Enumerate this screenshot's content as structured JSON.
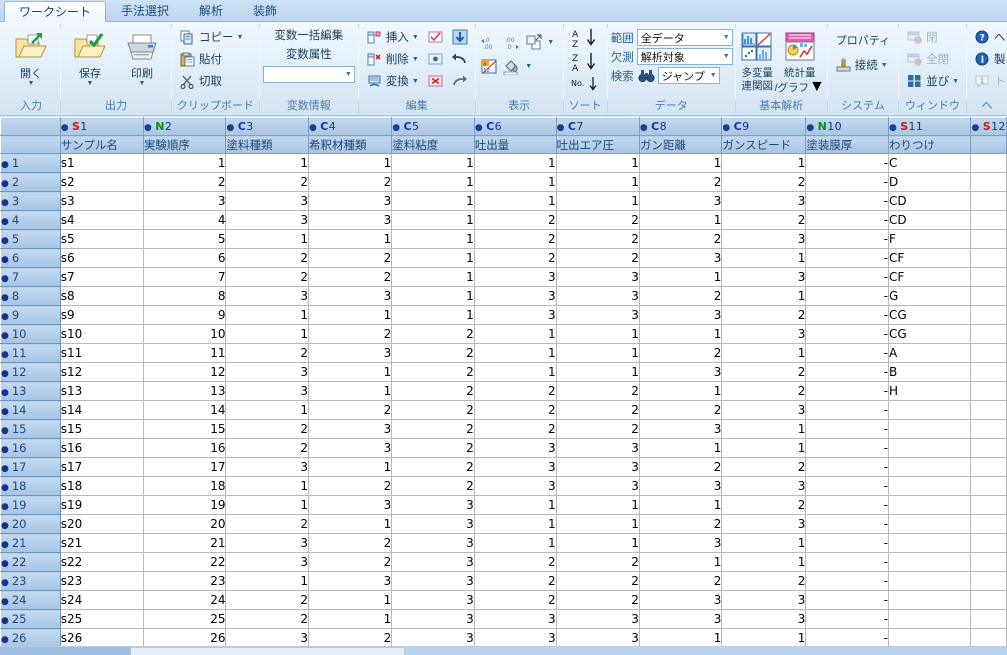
{
  "tabs": [
    {
      "label": "ワークシート",
      "active": true
    },
    {
      "label": "手法選択",
      "active": false
    },
    {
      "label": "解析",
      "active": false
    },
    {
      "label": "装飾",
      "active": false
    }
  ],
  "ribbon": {
    "groups": [
      {
        "title": "入力",
        "buttons": [
          {
            "label": "開く",
            "icon": "open-folder-icon",
            "dropdown": true
          }
        ]
      },
      {
        "title": "出力",
        "buttons": [
          {
            "label": "保存",
            "icon": "save-folder-icon",
            "dropdown": true
          },
          {
            "label": "印刷",
            "icon": "printer-icon",
            "dropdown": true
          }
        ]
      },
      {
        "title": "クリップボード",
        "buttons": [
          {
            "label": "コピー",
            "icon": "copy-icon",
            "dropdown": true
          },
          {
            "label": "貼付",
            "icon": "paste-icon",
            "dropdown": false
          },
          {
            "label": "切取",
            "icon": "scissors-icon",
            "dropdown": false
          }
        ]
      },
      {
        "title": "変数情報",
        "buttons": [
          {
            "label": "変数一括編集",
            "icon": "",
            "dropdown": false
          },
          {
            "label": "変数属性",
            "icon": "",
            "dropdown": false
          }
        ],
        "combo": {
          "value": "",
          "icon": "chevron-down-icon"
        }
      },
      {
        "title": "編集",
        "buttons": [
          {
            "label": "挿入",
            "icon": "insert-row-icon",
            "dropdown": true
          },
          {
            "label": "削除",
            "icon": "delete-row-icon",
            "dropdown": true
          },
          {
            "label": "変換",
            "icon": "convert-icon",
            "dropdown": true
          }
        ],
        "extra_icons": [
          "check-box-icon",
          "radio-cell-icon",
          "cross-cell-icon",
          "fill-down-icon",
          "undo-icon",
          "redo-icon"
        ]
      },
      {
        "title": "表示",
        "extra_icons": [
          "decimal-increase-icon",
          "decimal-decrease-icon",
          "resize-icon",
          "chevron-down-icon",
          "cell-format-icon",
          "fill-color-icon",
          "chevron-down-icon"
        ]
      },
      {
        "title": "ソート",
        "buttons": [
          {
            "label": "",
            "icon": "sort-az-icon"
          },
          {
            "label": "",
            "icon": "sort-za-icon"
          },
          {
            "label": "",
            "icon": "sort-no-icon"
          }
        ]
      },
      {
        "title": "データ",
        "fields": [
          {
            "label": "範囲",
            "value": "全データ",
            "type": "combo"
          },
          {
            "label": "欠測",
            "value": "解析対象",
            "type": "combo"
          },
          {
            "label": "検索",
            "value": "ジャンプ",
            "type": "combo",
            "icon": "binoculars-icon"
          }
        ]
      },
      {
        "title": "基本解析",
        "buttons": [
          {
            "label": "多変量\n連関図",
            "label_line1": "多変量",
            "label_line2": "連関図",
            "icon": "matrix-plot-icon"
          },
          {
            "label": "統計量\n/グラフ",
            "label_line1": "統計量",
            "label_line2": "/グラフ",
            "icon": "stats-graph-icon",
            "dropdown": true
          }
        ]
      },
      {
        "title": "システム",
        "buttons": [
          {
            "label": "プロパティ",
            "icon": ""
          },
          {
            "label": "接続",
            "icon": "connect-icon",
            "dropdown": true
          }
        ]
      },
      {
        "title": "ウィンドウ",
        "buttons": [
          {
            "label": "閉",
            "icon": "close-window-icon",
            "disabled": true
          },
          {
            "label": "全閉",
            "icon": "close-all-windows-icon",
            "disabled": true
          },
          {
            "label": "並び",
            "icon": "tile-windows-icon",
            "dropdown": true
          }
        ]
      },
      {
        "title": "ヘ",
        "buttons": [
          {
            "label": "ヘ",
            "icon": "help-icon"
          },
          {
            "label": "製",
            "icon": "info-icon"
          },
          {
            "label": "ト",
            "icon": "tip-icon",
            "disabled": true
          }
        ]
      }
    ]
  },
  "sheet": {
    "columns": [
      {
        "code_type": "S",
        "code_num": "1",
        "name": "サンプル名",
        "align": "txt",
        "width": 85
      },
      {
        "code_type": "N",
        "code_num": "2",
        "name": "実験順序",
        "align": "num",
        "width": 85
      },
      {
        "code_type": "C",
        "code_num": "3",
        "name": "塗料種類",
        "align": "num",
        "width": 85
      },
      {
        "code_type": "C",
        "code_num": "4",
        "name": "希釈材種類",
        "align": "num",
        "width": 85
      },
      {
        "code_type": "C",
        "code_num": "5",
        "name": "塗料粘度",
        "align": "num",
        "width": 85
      },
      {
        "code_type": "C",
        "code_num": "6",
        "name": "吐出量",
        "align": "num",
        "width": 85
      },
      {
        "code_type": "C",
        "code_num": "7",
        "name": "吐出エア圧",
        "align": "num",
        "width": 85
      },
      {
        "code_type": "C",
        "code_num": "8",
        "name": "ガン距離",
        "align": "num",
        "width": 85
      },
      {
        "code_type": "C",
        "code_num": "9",
        "name": "ガンスピード",
        "align": "num",
        "width": 85
      },
      {
        "code_type": "N",
        "code_num": "10",
        "name": "塗装膜厚",
        "align": "num",
        "width": 85
      },
      {
        "code_type": "S",
        "code_num": "11",
        "name": "わりつけ",
        "align": "txt",
        "width": 85
      },
      {
        "code_type": "S",
        "code_num": "12",
        "name": "",
        "align": "txt",
        "width": 22
      }
    ],
    "row_header_width": 62,
    "rows": [
      {
        "n": "1",
        "cells": [
          "s1",
          "1",
          "1",
          "1",
          "1",
          "1",
          "1",
          "1",
          "1",
          "-",
          "C",
          ""
        ]
      },
      {
        "n": "2",
        "cells": [
          "s2",
          "2",
          "2",
          "2",
          "1",
          "1",
          "1",
          "2",
          "2",
          "-",
          "D",
          ""
        ]
      },
      {
        "n": "3",
        "cells": [
          "s3",
          "3",
          "3",
          "3",
          "1",
          "1",
          "1",
          "3",
          "3",
          "-",
          "CD",
          ""
        ]
      },
      {
        "n": "4",
        "cells": [
          "s4",
          "4",
          "3",
          "3",
          "1",
          "2",
          "2",
          "1",
          "2",
          "-",
          "CD",
          ""
        ]
      },
      {
        "n": "5",
        "cells": [
          "s5",
          "5",
          "1",
          "1",
          "1",
          "2",
          "2",
          "2",
          "3",
          "-",
          "F",
          ""
        ]
      },
      {
        "n": "6",
        "cells": [
          "s6",
          "6",
          "2",
          "2",
          "1",
          "2",
          "2",
          "3",
          "1",
          "-",
          "CF",
          ""
        ]
      },
      {
        "n": "7",
        "cells": [
          "s7",
          "7",
          "2",
          "2",
          "1",
          "3",
          "3",
          "1",
          "3",
          "-",
          "CF",
          ""
        ]
      },
      {
        "n": "8",
        "cells": [
          "s8",
          "8",
          "3",
          "3",
          "1",
          "3",
          "3",
          "2",
          "1",
          "-",
          "G",
          ""
        ]
      },
      {
        "n": "9",
        "cells": [
          "s9",
          "9",
          "1",
          "1",
          "1",
          "3",
          "3",
          "3",
          "2",
          "-",
          "CG",
          ""
        ]
      },
      {
        "n": "10",
        "cells": [
          "s10",
          "10",
          "1",
          "2",
          "2",
          "1",
          "1",
          "1",
          "3",
          "-",
          "CG",
          ""
        ]
      },
      {
        "n": "11",
        "cells": [
          "s11",
          "11",
          "2",
          "3",
          "2",
          "1",
          "1",
          "2",
          "1",
          "-",
          "A",
          ""
        ]
      },
      {
        "n": "12",
        "cells": [
          "s12",
          "12",
          "3",
          "1",
          "2",
          "1",
          "1",
          "3",
          "2",
          "-",
          "B",
          ""
        ]
      },
      {
        "n": "13",
        "cells": [
          "s13",
          "13",
          "3",
          "1",
          "2",
          "2",
          "2",
          "1",
          "2",
          "-",
          "H",
          ""
        ]
      },
      {
        "n": "14",
        "cells": [
          "s14",
          "14",
          "1",
          "2",
          "2",
          "2",
          "2",
          "2",
          "3",
          "-",
          "",
          ""
        ]
      },
      {
        "n": "15",
        "cells": [
          "s15",
          "15",
          "2",
          "3",
          "2",
          "2",
          "2",
          "3",
          "1",
          "-",
          "",
          ""
        ]
      },
      {
        "n": "16",
        "cells": [
          "s16",
          "16",
          "2",
          "3",
          "2",
          "3",
          "3",
          "1",
          "1",
          "-",
          "",
          ""
        ]
      },
      {
        "n": "17",
        "cells": [
          "s17",
          "17",
          "3",
          "1",
          "2",
          "3",
          "3",
          "2",
          "2",
          "-",
          "",
          ""
        ]
      },
      {
        "n": "18",
        "cells": [
          "s18",
          "18",
          "1",
          "2",
          "2",
          "3",
          "3",
          "3",
          "3",
          "-",
          "",
          ""
        ]
      },
      {
        "n": "19",
        "cells": [
          "s19",
          "19",
          "1",
          "3",
          "3",
          "1",
          "1",
          "1",
          "2",
          "-",
          "",
          ""
        ]
      },
      {
        "n": "20",
        "cells": [
          "s20",
          "20",
          "2",
          "1",
          "3",
          "1",
          "1",
          "2",
          "3",
          "-",
          "",
          ""
        ]
      },
      {
        "n": "21",
        "cells": [
          "s21",
          "21",
          "3",
          "2",
          "3",
          "1",
          "1",
          "3",
          "1",
          "-",
          "",
          ""
        ]
      },
      {
        "n": "22",
        "cells": [
          "s22",
          "22",
          "3",
          "2",
          "3",
          "2",
          "2",
          "1",
          "1",
          "-",
          "",
          ""
        ]
      },
      {
        "n": "23",
        "cells": [
          "s23",
          "23",
          "1",
          "3",
          "3",
          "2",
          "2",
          "2",
          "2",
          "-",
          "",
          ""
        ]
      },
      {
        "n": "24",
        "cells": [
          "s24",
          "24",
          "2",
          "1",
          "3",
          "2",
          "2",
          "3",
          "3",
          "-",
          "",
          ""
        ]
      },
      {
        "n": "25",
        "cells": [
          "s25",
          "25",
          "2",
          "1",
          "3",
          "3",
          "3",
          "3",
          "3",
          "-",
          "",
          ""
        ]
      },
      {
        "n": "26",
        "cells": [
          "s26",
          "26",
          "3",
          "2",
          "3",
          "3",
          "3",
          "1",
          "1",
          "-",
          "",
          ""
        ]
      }
    ]
  },
  "colors": {
    "accent": "#1b4a7c",
    "header_bg": "#a9c6e4",
    "type_s": "#d61414",
    "type_n": "#0a8c1e",
    "type_c": "#1330a8",
    "ribbon_bg": "#e3eff9"
  }
}
